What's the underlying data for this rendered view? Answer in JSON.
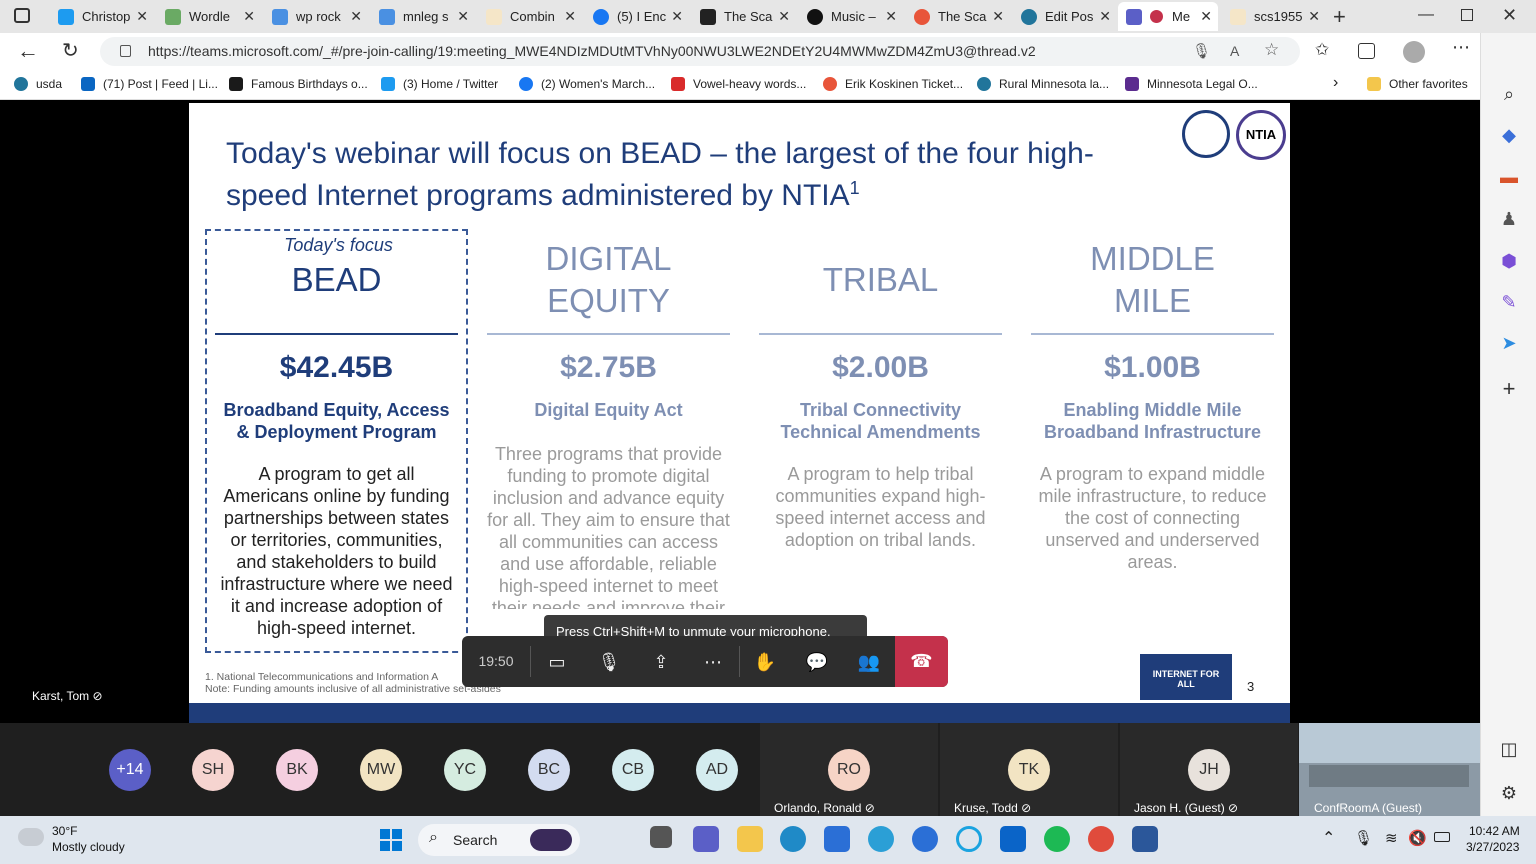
{
  "browser": {
    "tabs": [
      {
        "title": "Christop",
        "color": "#1d9bf0"
      },
      {
        "title": "Wordle",
        "color": "#6aaa64"
      },
      {
        "title": "wp rock",
        "color": "#4a90e2"
      },
      {
        "title": "mnleg s",
        "color": "#4a90e2"
      },
      {
        "title": "Combin",
        "color": "#f5e6c8"
      },
      {
        "title": "(5) I Enc",
        "color": "#1877f2"
      },
      {
        "title": "The Sca",
        "color": "#222222"
      },
      {
        "title": "Music –",
        "color": "#111111"
      },
      {
        "title": "The Sca",
        "color": "#e8553a"
      },
      {
        "title": "Edit Pos",
        "color": "#21759b"
      },
      {
        "title": "Me",
        "color": "#5b5fc7"
      },
      {
        "title": "scs1955",
        "color": "#f5e6c8"
      }
    ],
    "url": "https://teams.microsoft.com/_#/pre-join-calling/19:meeting_MWE4NDIzMDUtMTVhNy00NWU3LWE2NDEtY2U4MWMwZDM4ZmU3@thread.v2",
    "bookmarks": [
      {
        "label": "usda",
        "color": "#21759b"
      },
      {
        "label": "(71) Post | Feed | Li...",
        "color": "#0a66c2"
      },
      {
        "label": "Famous Birthdays o...",
        "color": "#1a1a1a"
      },
      {
        "label": "(3) Home / Twitter",
        "color": "#1d9bf0"
      },
      {
        "label": "(2) Women's March...",
        "color": "#1877f2"
      },
      {
        "label": "Vowel-heavy words...",
        "color": "#d92b2b"
      },
      {
        "label": "Erik Koskinen Ticket...",
        "color": "#e8553a"
      },
      {
        "label": "Rural Minnesota la...",
        "color": "#21759b"
      },
      {
        "label": "Minnesota Legal O...",
        "color": "#5b2c8f"
      }
    ],
    "other_favorites": "Other favorites"
  },
  "slide": {
    "title": "Today's webinar will focus on BEAD – the largest of the four high-speed Internet programs administered by NTIA",
    "title_sup": "1",
    "focus_label": "Today's focus",
    "columns": [
      {
        "head": "BEAD",
        "amount": "$42.45B",
        "program": "Broadband Equity, Access & Deployment Program",
        "desc": "A program to get all Americans online by funding partnerships between states or territories, communities, and stakeholders to build infrastructure where we need it and increase adoption of high-speed internet."
      },
      {
        "head": "DIGITAL EQUITY",
        "amount": "$2.75B",
        "program": "Digital Equity Act",
        "desc": "Three programs that provide funding to promote digital inclusion and advance equity for all. They aim to ensure that all communities can access and use affordable, reliable high-speed internet to meet their needs and improve their lives"
      },
      {
        "head": "TRIBAL",
        "amount": "$2.00B",
        "program": "Tribal Connectivity Technical Amendments",
        "desc": "A program to help tribal communities expand high-speed internet access and adoption on tribal lands."
      },
      {
        "head": "MIDDLE MILE",
        "amount": "$1.00B",
        "program": "Enabling Middle Mile Broadband Infrastructure",
        "desc": "A program to expand middle mile infrastructure, to reduce the cost of connecting unserved and underserved areas."
      }
    ],
    "footnote1": "1. National Telecommunications and Information A",
    "footnote2": "Note: Funding amounts inclusive of all administrative set-asides",
    "page": "3",
    "logo_text": "INTERNET FOR ALL",
    "ntia_text": "NTIA"
  },
  "call": {
    "tooltip": "Press Ctrl+Shift+M to unmute your microphone.",
    "timer": "19:50",
    "speaker": "Karst, Tom"
  },
  "participants": {
    "overflow": "+14",
    "avatars": [
      {
        "initials": "SH",
        "color": "#f6d4d0"
      },
      {
        "initials": "BK",
        "color": "#f5cfe0"
      },
      {
        "initials": "MW",
        "color": "#f2e4c3"
      },
      {
        "initials": "YC",
        "color": "#d5ece0"
      },
      {
        "initials": "BC",
        "color": "#d3dcf0"
      },
      {
        "initials": "CB",
        "color": "#d4ecef"
      },
      {
        "initials": "AD",
        "color": "#d4ecef"
      }
    ],
    "tiles": [
      {
        "initials": "RO",
        "name": "Orlando, Ronald",
        "color": "#f6d4c6"
      },
      {
        "initials": "TK",
        "name": "Kruse, Todd",
        "color": "#f2e4c3"
      },
      {
        "initials": "JH",
        "name": "Jason H. (Guest)",
        "color": "#e8e2dc"
      }
    ],
    "room": "ConfRoomA (Guest)"
  },
  "taskbar": {
    "temperature": "30°F",
    "weather": "Mostly cloudy",
    "search": "Search",
    "time": "10:42 AM",
    "date": "3/27/2023"
  }
}
